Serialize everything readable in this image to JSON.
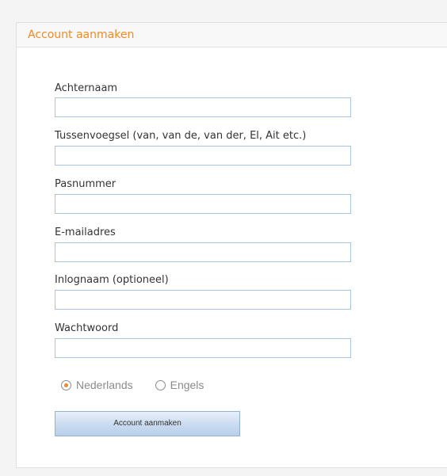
{
  "panel": {
    "title": "Account aanmaken",
    "accent_color": "#f08a24"
  },
  "form": {
    "fields": [
      {
        "label": "Achternaam",
        "value": ""
      },
      {
        "label": "Tussenvoegsel (van, van de, van der, El, Ait etc.)",
        "value": ""
      },
      {
        "label": "Pasnummer",
        "value": ""
      },
      {
        "label": "E-mailadres",
        "value": ""
      },
      {
        "label": "Inlognaam (optioneel)",
        "value": ""
      },
      {
        "label": "Wachtwoord",
        "value": ""
      }
    ],
    "language_options": [
      {
        "label": "Nederlands",
        "selected": true
      },
      {
        "label": "Engels",
        "selected": false
      }
    ],
    "submit_label": "Account aanmaken"
  }
}
